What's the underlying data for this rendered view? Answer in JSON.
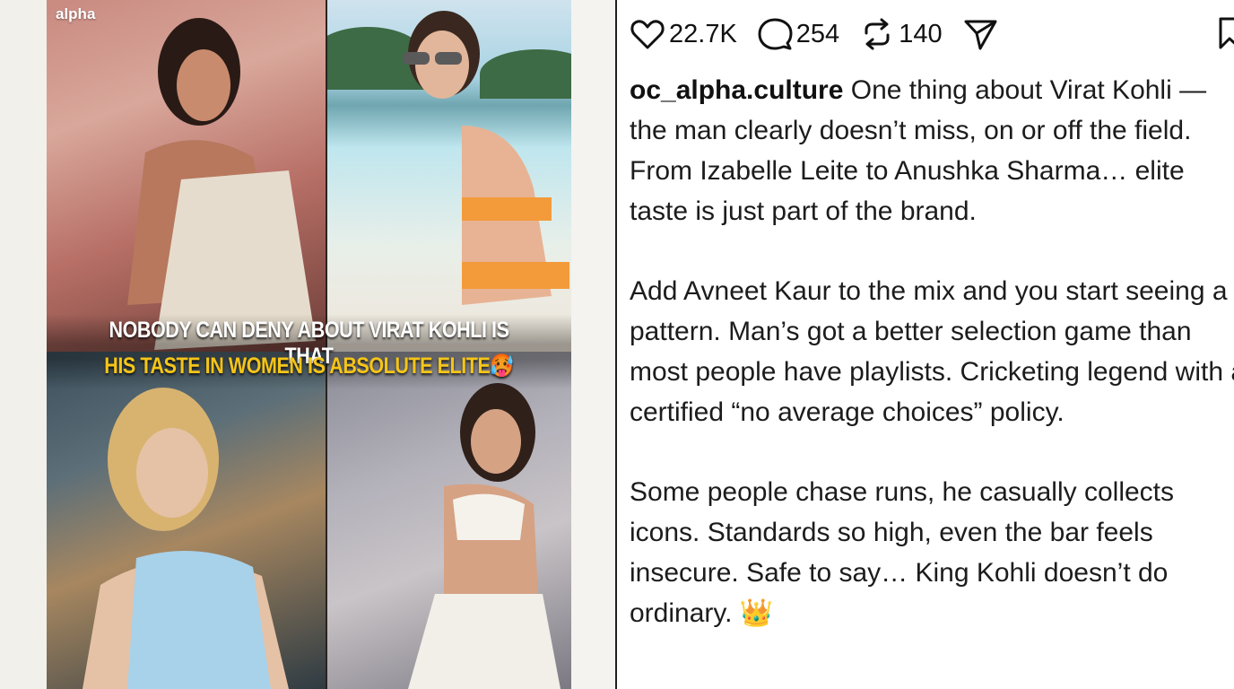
{
  "collage": {
    "brand": "alpha",
    "headline_line1": "NOBODY CAN DENY ABOUT VIRAT KOHLI IS THAT",
    "headline_line2": "HIS TASTE IN WOMEN IS ABSOLUTE ELITE",
    "headline_emoji": "🥵",
    "accent_color": "#f5c518"
  },
  "post": {
    "actions": {
      "likes": "22.7K",
      "comments": "254",
      "reposts": "140"
    },
    "username": "oc_alpha.culture",
    "caption_para1": " One thing about Virat Kohli — the man clearly doesn’t miss, on or off the field. From Izabelle Leite to Anushka Sharma… elite taste is just part of the brand.",
    "caption_para2": "Add Avneet Kaur to the mix and you start seeing a pattern. Man’s got a better selection game than most people have playlists. Cricketing legend with a certified “no average choices” policy.",
    "caption_para3": "Some people chase runs, he casually collects icons. Standards so high, even the bar feels insecure. Safe to say… King Kohli doesn’t do ordinary. 👑"
  }
}
